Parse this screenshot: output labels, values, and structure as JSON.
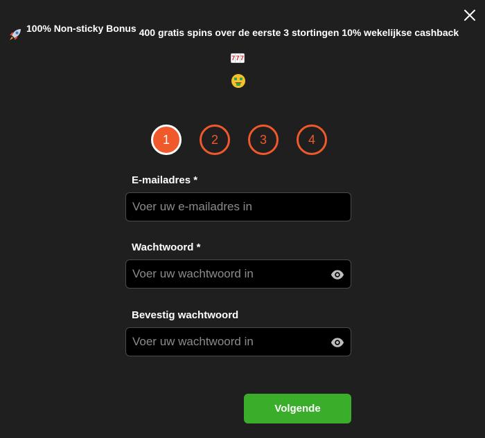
{
  "promo": {
    "segment1": "100% Non-sticky Bonus",
    "segment2": "400 gratis spins over de eerste 3 stortingen 10% wekelijkse cashback",
    "rocket_icon": "rocket-icon",
    "slot_icon": "slot-machine-icon",
    "slot_reels": [
      "7",
      "7",
      "7"
    ],
    "money_icon": "money-mouth-face-icon"
  },
  "steps": [
    {
      "label": "1",
      "active": true
    },
    {
      "label": "2",
      "active": false
    },
    {
      "label": "3",
      "active": false
    },
    {
      "label": "4",
      "active": false
    }
  ],
  "form": {
    "email": {
      "label": "E-mailadres  *",
      "placeholder": "Voer uw e-mailadres in",
      "value": ""
    },
    "password": {
      "label": "Wachtwoord  *",
      "placeholder": "Voer uw wachtwoord in",
      "value": ""
    },
    "confirm": {
      "label": "Bevestig wachtwoord",
      "placeholder": "Voer uw wachtwoord in",
      "value": ""
    }
  },
  "next_button": "Volgende",
  "colors": {
    "accent": "#f0592a",
    "button": "#3aae2a",
    "background": "#1f1f1f",
    "input_bg": "#000000"
  }
}
